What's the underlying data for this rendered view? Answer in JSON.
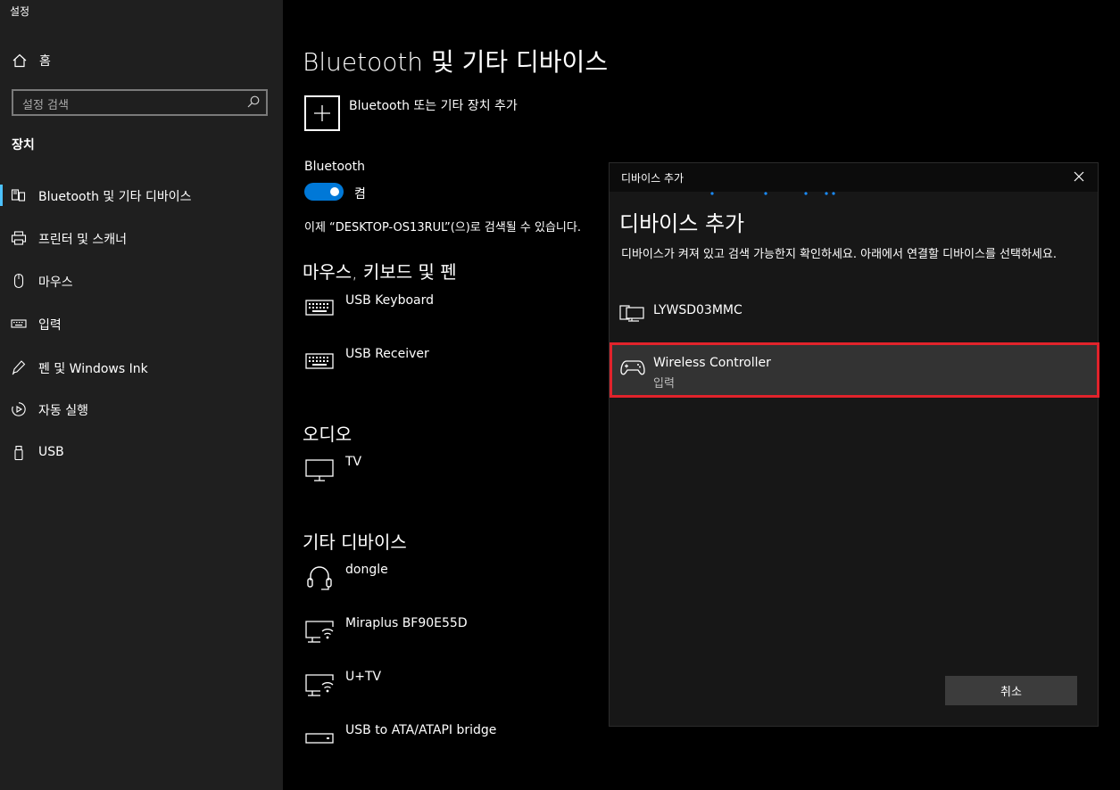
{
  "app": {
    "title": "설정"
  },
  "sidebar": {
    "home_label": "홈",
    "search_placeholder": "설정 검색",
    "section": "장치",
    "items": [
      {
        "label": "Bluetooth 및 기타 디바이스",
        "icon": "bluetooth-devices-icon",
        "active": true
      },
      {
        "label": "프린터 및 스캐너",
        "icon": "printer-icon"
      },
      {
        "label": "마우스",
        "icon": "mouse-icon"
      },
      {
        "label": "입력",
        "icon": "keyboard-icon"
      },
      {
        "label": "펜 및 Windows Ink",
        "icon": "pen-icon"
      },
      {
        "label": "자동 실행",
        "icon": "autoplay-icon"
      },
      {
        "label": "USB",
        "icon": "usb-icon"
      }
    ]
  },
  "main": {
    "title": "Bluetooth 및 기타 디바이스",
    "add_device_label": "Bluetooth 또는 기타 장치 추가",
    "bluetooth_label": "Bluetooth",
    "bluetooth_state": "켬",
    "discoverable_text": "이제 “DESKTOP-OS13RUL”(으)로 검색될 수 있습니다.",
    "groups": [
      {
        "title": "마우스, 키보드 및 펜",
        "devices": [
          {
            "name": "USB Keyboard",
            "icon": "keyboard-icon"
          },
          {
            "name": "USB Receiver",
            "icon": "keyboard-icon"
          }
        ]
      },
      {
        "title": "오디오",
        "devices": [
          {
            "name": "TV",
            "icon": "monitor-icon"
          }
        ]
      },
      {
        "title": "기타 디바이스",
        "devices": [
          {
            "name": "dongle",
            "icon": "headset-icon"
          },
          {
            "name": "Miraplus BF90E55D",
            "icon": "wireless-display-icon"
          },
          {
            "name": "U+TV",
            "icon": "wireless-display-icon"
          },
          {
            "name": "USB to ATA/ATAPI bridge",
            "icon": "drive-icon"
          }
        ]
      }
    ]
  },
  "dialog": {
    "window_title": "디바이스 추가",
    "heading": "디바이스 추가",
    "description": "디바이스가 켜져 있고 검색 가능한지 확인하세요. 아래에서 연결할 디바이스를 선택하세요.",
    "devices": [
      {
        "name": "LYWSD03MMC",
        "subtitle": "",
        "icon": "generic-device-icon"
      },
      {
        "name": "Wireless Controller",
        "subtitle": "입력",
        "icon": "gamepad-icon",
        "selected": true
      }
    ],
    "cancel_label": "취소",
    "highlight_color": "#e1232b"
  },
  "colors": {
    "accent": "#0078d7"
  }
}
